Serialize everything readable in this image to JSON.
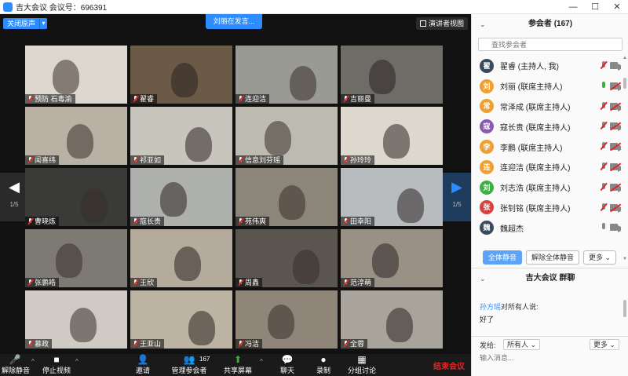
{
  "window": {
    "title": "吉大会议  会议号：696391",
    "minimize": "—",
    "maximize": "☐",
    "close": "✕"
  },
  "video": {
    "close_original": "关闭原声",
    "speaking": "刘丽在发言...",
    "speaker_view": "演讲者视图",
    "page_left": "1/5",
    "page_right": "1/5",
    "tiles": [
      {
        "name": "预防 石毒渝",
        "bg": "#dcd7cf"
      },
      {
        "name": "翟睿",
        "bg": "#6b5a46"
      },
      {
        "name": "连迎洁",
        "bg": "#9a9a94"
      },
      {
        "name": "吉丽曼",
        "bg": "#6e6c66"
      },
      {
        "name": "闻喜纬",
        "bg": "#b9b2a4"
      },
      {
        "name": "祁亚如",
        "bg": "#c8c5bc"
      },
      {
        "name": "信息刘芬瑶",
        "bg": "#bdbab2"
      },
      {
        "name": "孙玲玲",
        "bg": "#ddd8ce"
      },
      {
        "name": "曹晓炼",
        "bg": "#3a3a38"
      },
      {
        "name": "寇长贵",
        "bg": "#aeb0ad"
      },
      {
        "name": "苑伟爽",
        "bg": "#8c857a"
      },
      {
        "name": "田幸阳",
        "bg": "#b8bcbf"
      },
      {
        "name": "张鹏皓",
        "bg": "#7d7a74"
      },
      {
        "name": "王欣",
        "bg": "#b4ab9c"
      },
      {
        "name": "周鑫",
        "bg": "#5a564f"
      },
      {
        "name": "范淳萌",
        "bg": "#9a9186"
      },
      {
        "name": "慕政",
        "bg": "#cfcbc4"
      },
      {
        "name": "王亚山",
        "bg": "#bdb3a3"
      },
      {
        "name": "冯洁",
        "bg": "#8f8578"
      },
      {
        "name": "全蓉",
        "bg": "#a9a49b"
      }
    ]
  },
  "toolbar": {
    "unmute": "解除静音",
    "stop_video": "停止视频",
    "invite": "邀请",
    "manage": "管理参会者",
    "participant_count": "167",
    "share": "共享屏幕",
    "chat": "聊天",
    "record": "录制",
    "breakout": "分组讨论",
    "end": "结束会议"
  },
  "panel": {
    "participants_title": "参会者 (167)",
    "search_placeholder": "查找参会者",
    "participants": [
      {
        "avatar": "翟",
        "color": "#3a4a5c",
        "name": "翟睿 (主持人, 我)",
        "mic": "muted",
        "cam": "on"
      },
      {
        "avatar": "刘",
        "color": "#f0a030",
        "name": "刘丽 (联席主持人)",
        "mic": "active",
        "cam": "off"
      },
      {
        "avatar": "常",
        "color": "#f0a030",
        "name": "常泽成 (联席主持人)",
        "mic": "muted",
        "cam": "off"
      },
      {
        "avatar": "寇",
        "color": "#8a5ab0",
        "name": "寇长贵 (联席主持人)",
        "mic": "muted",
        "cam": "off"
      },
      {
        "avatar": "李",
        "color": "#f0a030",
        "name": "李鹏 (联席主持人)",
        "mic": "muted",
        "cam": "off"
      },
      {
        "avatar": "连",
        "color": "#f0a030",
        "name": "连迎洁 (联席主持人)",
        "mic": "muted",
        "cam": "off"
      },
      {
        "avatar": "刘",
        "color": "#3cb043",
        "name": "刘志浩 (联席主持人)",
        "mic": "muted",
        "cam": "off"
      },
      {
        "avatar": "张",
        "color": "#d94040",
        "name": "张钊铭 (联席主持人)",
        "mic": "muted",
        "cam": "off"
      },
      {
        "avatar": "魏",
        "color": "#3a4a5c",
        "name": "魏超杰",
        "mic": "on",
        "cam": "on"
      }
    ],
    "mute_all": "全体静音",
    "unmute_all": "解除全体静音",
    "more": "更多 ⌄",
    "chat_title": "吉大会议 群聊",
    "chat_sender": "孙方瑶",
    "chat_to": "对所有人说:",
    "chat_message": "好了",
    "send_to_label": "发给:",
    "send_to_value": "所有人 ⌄",
    "chat_more": "更多 ⌄",
    "input_placeholder": "输入消息..."
  }
}
